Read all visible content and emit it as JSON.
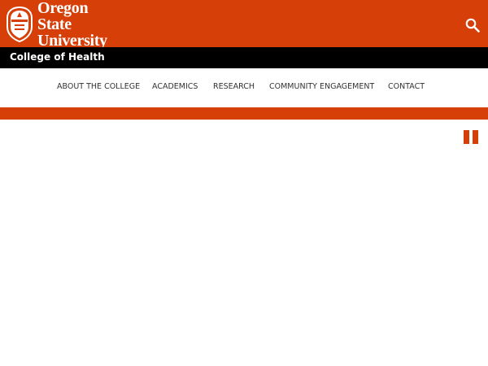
{
  "header": {
    "university_name_line1": "Oregon State",
    "university_name_line2": "University",
    "search_icon": "search-icon",
    "brand_color": "#d73f09"
  },
  "unit": {
    "title": "College of Health"
  },
  "nav": {
    "items": [
      {
        "label": "ABOUT THE COLLEGE"
      },
      {
        "label": "ACADEMICS"
      },
      {
        "label": "RESEARCH"
      },
      {
        "label": "COMMUNITY ENGAGEMENT"
      },
      {
        "label": "CONTACT"
      }
    ]
  },
  "slideshow": {
    "control_icon": "pause-icon"
  }
}
